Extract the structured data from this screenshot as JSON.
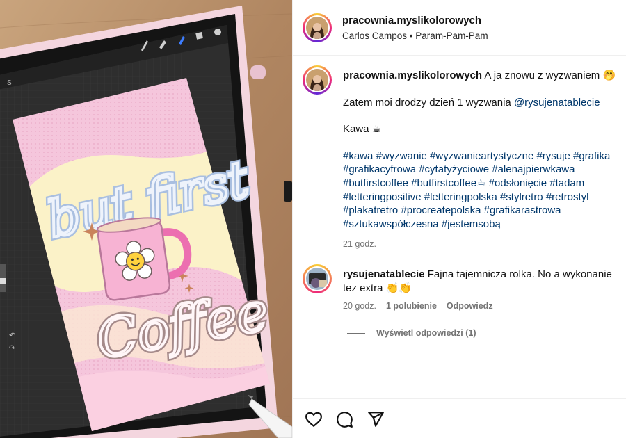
{
  "post": {
    "author": "pracownia.myslikolorowych",
    "location_line": {
      "audio_artist": "Carlos Campos",
      "separator": "•",
      "audio_title": "Param-Pam-Pam"
    },
    "caption": {
      "author": "pracownia.myslikolorowych",
      "line1": "A ja znowu z wyzwaniem 🤭",
      "line2_prefix": "Zatem moi drodzy dzień 1 wyzwania ",
      "line2_mention": "@rysujenatablecie",
      "line3": "Kawa ☕",
      "hashtags": "#kawa #wyzwanie #wyzwanieartystyczne #rysuje #grafika #grafikacyfrowa #cytatyżyciowe #alenajpierwkawa #butfirstcoffee #butfirstcoffee☕ #odsłonięcie #tadam #letteringpositive #letteringpolska #stylretro #retrostyl #plakatretro #procreatepolska #grafikarastrowa #sztukawspółczesna #jestemsobą",
      "time": "21 godz."
    },
    "comment": {
      "author": "rysujenatablecie",
      "text": "Fajna tajemnicza rolka. No a wykonanie tez extra 👏👏",
      "time": "20 godz.",
      "likes": "1 polubienie",
      "reply": "Odpowiedz",
      "view_replies": "Wyświetl odpowiedzi (1)"
    },
    "actions": {
      "like_icon": "heart-icon",
      "comment_icon": "comment-icon",
      "share_icon": "share-icon"
    }
  },
  "artwork": {
    "top_text": "but first",
    "bottom_text": "Coffee"
  },
  "colors": {
    "pink_bg": "#f5c6dc",
    "cream_band": "#fbf2c8",
    "link": "#00376b",
    "muted": "#737373"
  }
}
